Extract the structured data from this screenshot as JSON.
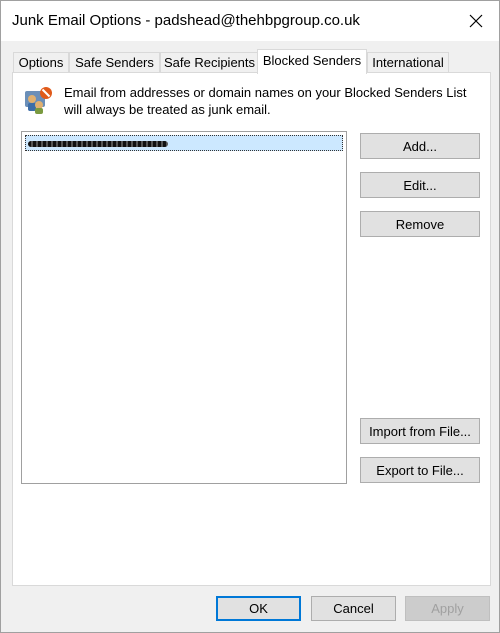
{
  "window": {
    "title": "Junk Email Options - padshead@thehbpgroup.co.uk"
  },
  "tabs": [
    {
      "label": "Options"
    },
    {
      "label": "Safe Senders"
    },
    {
      "label": "Safe Recipients"
    },
    {
      "label": "Blocked Senders",
      "active": true
    },
    {
      "label": "International"
    }
  ],
  "panel": {
    "description": "Email from addresses or domain names on your Blocked Senders List will always be treated as junk email.",
    "icon": "junk-mail-blocked-icon",
    "list": {
      "items": [
        {
          "label": "",
          "redacted": true,
          "selected": true
        }
      ]
    },
    "buttons": {
      "add": "Add...",
      "edit": "Edit...",
      "remove": "Remove",
      "import": "Import from File...",
      "export": "Export to File..."
    }
  },
  "footer": {
    "ok": "OK",
    "cancel": "Cancel",
    "apply": "Apply"
  },
  "colors": {
    "accent": "#0078d7",
    "selection": "#cce8ff"
  }
}
